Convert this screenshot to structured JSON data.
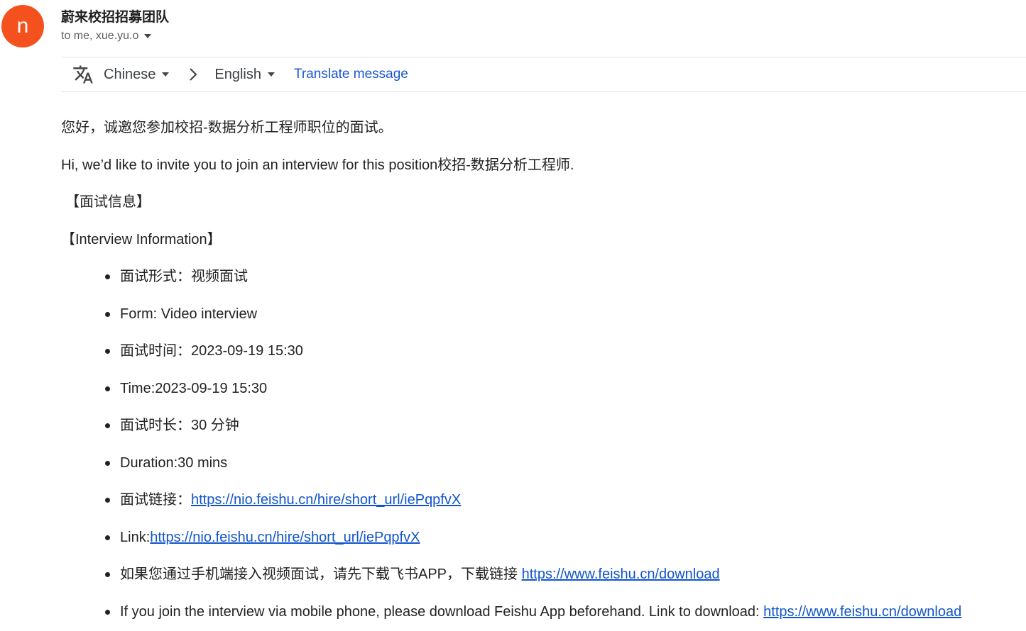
{
  "sender": {
    "avatar_letter": "n",
    "avatar_color": "#f4511e",
    "name": "蔚来校招招募团队",
    "recipients": "to me, xue.yu.o"
  },
  "translation": {
    "source_lang": "Chinese",
    "target_lang": "English",
    "action": "Translate message",
    "icons": [
      "translate-icon",
      "chevron-right-icon"
    ]
  },
  "message": {
    "greeting_zh": "您好，诚邀您参加校招-数据分析工程师职位的面试。",
    "greeting_en": "Hi, we’d like to invite you to join an interview for this position校招-数据分析工程师.",
    "section_zh": "【面试信息】",
    "section_en": "【Interview Information】",
    "items": {
      "form_zh": "面试形式：视频面试",
      "form_en": "Form: Video interview",
      "time_zh": "面试时间：2023-09-19 15:30",
      "time_en": "Time:2023-09-19 15:30",
      "duration_zh": "面试时长：30 分钟",
      "duration_en": "Duration:30 mins",
      "link_zh_label": "面试链接：",
      "link_zh_url": "https://nio.feishu.cn/hire/short_url/iePqpfvX",
      "link_en_label": "Link:",
      "link_en_url": "https://nio.feishu.cn/hire/short_url/iePqpfvX",
      "mobile_zh_label": "如果您通过手机端接入视频面试，请先下载飞书APP，下载链接 ",
      "mobile_zh_url": "https://www.feishu.cn/download",
      "mobile_en_label": "If you join the interview via mobile phone, please download Feishu App beforehand. Link to download: ",
      "mobile_en_url": "https://www.feishu.cn/download"
    }
  },
  "colors": {
    "link": "#1155cc",
    "translate_link": "#1a57d1",
    "text": "#222222"
  }
}
